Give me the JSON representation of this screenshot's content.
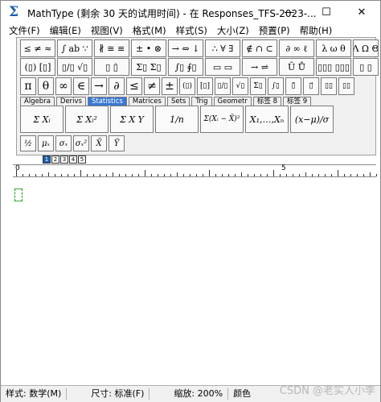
{
  "window": {
    "title": "MathType (剩余 30 天的试用时间) - 在 Responses_TFS-2023-...",
    "minimize": "—",
    "maximize": "☐",
    "close": "✕",
    "icon": "sigma-icon"
  },
  "menu": [
    "文件(F)",
    "编辑(E)",
    "视图(V)",
    "格式(M)",
    "样式(S)",
    "大小(Z)",
    "预置(P)",
    "帮助(H)"
  ],
  "toolbar": {
    "row1": [
      "≤ ≠ ≈",
      "∫ ab ∵",
      "∦ ≅ ≡",
      "± • ⊗",
      "→ ⇔ ↓",
      "∴ ∀ ∃",
      "∉ ∩ ⊂",
      "∂ ∞ ℓ",
      "λ ω θ",
      "Λ Ω Θ"
    ],
    "row2": [
      "(▯) [▯]",
      "▯/▯ √▯",
      "▯ ▯̇",
      "Σ▯ Σ▯",
      "∫▯ ∮▯",
      "▭ ▭",
      "→ ⇌",
      "Ū Ů",
      "▯▯▯ ▯▯▯",
      "▯ ▯"
    ],
    "row3": [
      "π",
      "θ",
      "∞",
      "∈",
      "→",
      "∂",
      "≤",
      "≠",
      "±",
      "(▯)",
      "[▯]",
      "▯/▯",
      "√▯",
      "Σ▯",
      "∫▯",
      "▯̄",
      "▯⃗",
      "▯▯",
      "▯▯"
    ],
    "tabs": [
      "Algebra",
      "Derivs",
      "Statistics",
      "Matrices",
      "Sets",
      "Trig",
      "Geometr",
      "标签 8",
      "标签 9"
    ],
    "active_tab": "Statistics",
    "templates": [
      "Σ Xᵢ",
      "Σ Xᵢ²",
      "Σ X Y",
      "1/n",
      "Σ(Xᵢ − X̄)²",
      "X₁,…,Xₙ",
      "(x−μ)/σ"
    ],
    "small": [
      "½",
      "μₓ",
      "σₓ",
      "σₓ²",
      "X̄",
      "Ȳ"
    ]
  },
  "mini_tabs": [
    "1",
    "2",
    "3",
    "4",
    "5"
  ],
  "ruler": {
    "start": "0",
    "mark": "5"
  },
  "status": {
    "style": "样式: 数学(M)",
    "size": "尺寸: 标准(F)",
    "zoom": "缩放: 200%",
    "color": "颜色"
  },
  "watermark": "CSDN @老实人小李"
}
